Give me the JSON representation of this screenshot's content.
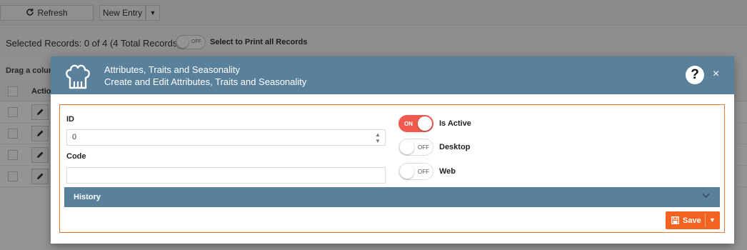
{
  "toolbar": {
    "refresh_label": "Refresh",
    "new_entry_label": "New Entry"
  },
  "selection": {
    "records_text": "Selected Records: 0 of 4 (4 Total Records)",
    "toggle_state": "OFF",
    "print_all_label": "Select to Print all Records"
  },
  "grid": {
    "drag_hint": "Drag a column",
    "actions_header": "Actions",
    "row_count": 4
  },
  "dialog": {
    "title": "Attributes, Traits and Seasonality",
    "subtitle": "Create and Edit Attributes, Traits and Seasonality",
    "help_symbol": "?",
    "close_symbol": "×",
    "fields": {
      "id_label": "ID",
      "id_value": "0",
      "code_label": "Code",
      "code_value": ""
    },
    "toggles": [
      {
        "label": "Is Active",
        "state": "ON"
      },
      {
        "label": "Desktop",
        "state": "OFF"
      },
      {
        "label": "Web",
        "state": "OFF"
      }
    ],
    "history_label": "History",
    "save_label": "Save"
  },
  "colors": {
    "header": "#5a819b",
    "accent_orange": "#f4621f",
    "toggle_on": "#f05a4e",
    "body_border": "#e07a3a"
  }
}
